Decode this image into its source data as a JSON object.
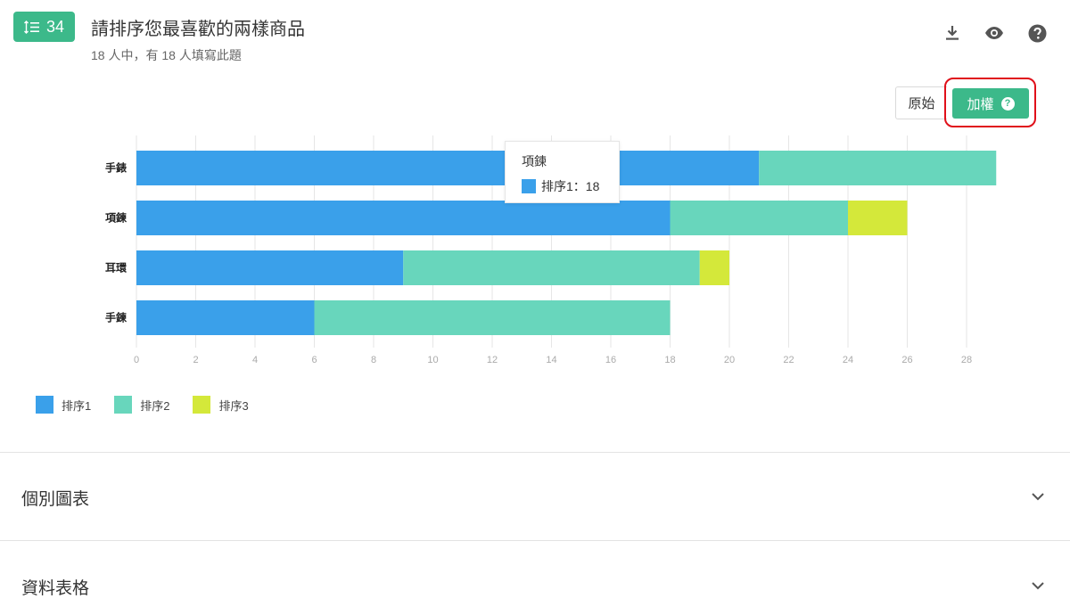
{
  "question": {
    "number": "34",
    "title": "請排序您最喜歡的兩樣商品",
    "subtitle": "18 人中，有 18 人填寫此題"
  },
  "toolbar": {
    "download_icon": "download-icon",
    "preview_icon": "eye-icon",
    "help_icon": "help-icon"
  },
  "mode_toggle": {
    "original_label": "原始",
    "weighted_label": "加權",
    "selected": "weighted",
    "weighted_help_icon": "question-circle-icon"
  },
  "colors": {
    "accent": "#3cb98a",
    "series1": "#3aa0ea",
    "series2": "#68d6bc",
    "series3": "#d4e83a",
    "highlight": "#e0101a"
  },
  "chart_data": {
    "type": "bar",
    "orientation": "horizontal",
    "stacked": true,
    "categories": [
      "手錶",
      "項鍊",
      "耳環",
      "手鍊"
    ],
    "series": [
      {
        "name": "排序1",
        "values": [
          21,
          18,
          9,
          6
        ]
      },
      {
        "name": "排序2",
        "values": [
          8,
          6,
          10,
          12
        ]
      },
      {
        "name": "排序3",
        "values": [
          0,
          2,
          1,
          0
        ]
      }
    ],
    "xlim": [
      0,
      29
    ],
    "xticks": [
      0,
      2,
      4,
      6,
      8,
      10,
      12,
      14,
      16,
      18,
      20,
      22,
      24,
      26,
      28
    ],
    "grid": true,
    "legend": "bottom-left"
  },
  "tooltip": {
    "title": "項鍊",
    "series_label": "排序1：18"
  },
  "sections": [
    {
      "title": "個別圖表"
    },
    {
      "title": "資料表格"
    }
  ]
}
